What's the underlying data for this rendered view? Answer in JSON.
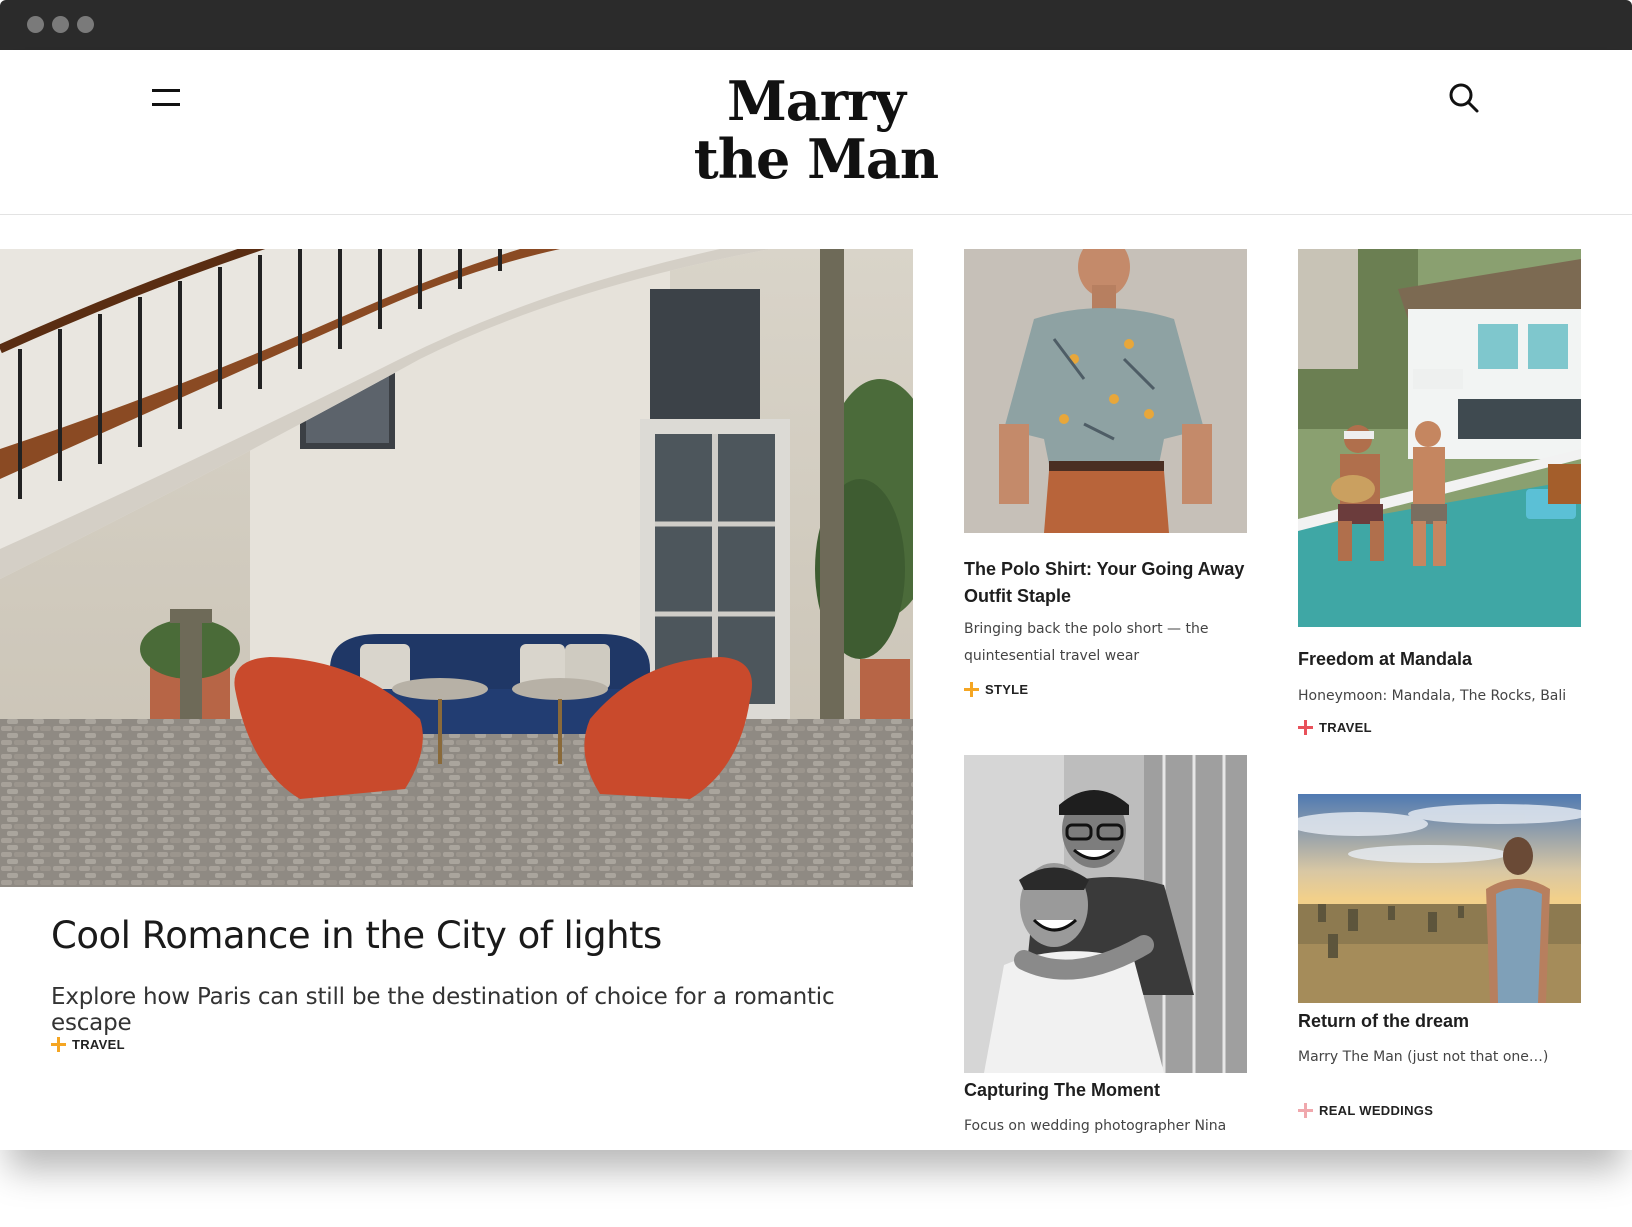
{
  "window": {
    "buttons": [
      "close",
      "minimize",
      "maximize"
    ]
  },
  "header": {
    "menu_icon": "hamburger-menu-icon",
    "logo_line1": "Marry",
    "logo_line2": "the Man",
    "search_icon": "search-icon"
  },
  "hero": {
    "title": "Cool Romance in the City of lights",
    "description": "Explore how Paris can still be the destination of choice for a romantic escape",
    "tag": "TRAVEL",
    "tag_color": "#f5a623"
  },
  "cards": [
    {
      "title_line1": "The Polo Shirt: Your Going Away",
      "title_line2": "Outfit Staple",
      "desc_line1": "Bringing back the polo short — the",
      "desc_line2": "quintesential travel wear",
      "tag": "STYLE",
      "tag_color": "#f5a623"
    },
    {
      "title": "Freedom at Mandala",
      "desc": "Honeymoon: Mandala, The Rocks, Bali",
      "tag": "TRAVEL",
      "tag_color": "#e8515a"
    },
    {
      "title": "Capturing The Moment",
      "desc": "Focus on wedding photographer Nina"
    },
    {
      "title": "Return of the dream",
      "desc": "Marry The Man (just not that one…)",
      "tag": "REAL WEDDINGS",
      "tag_color": "#f0a8ad"
    }
  ]
}
